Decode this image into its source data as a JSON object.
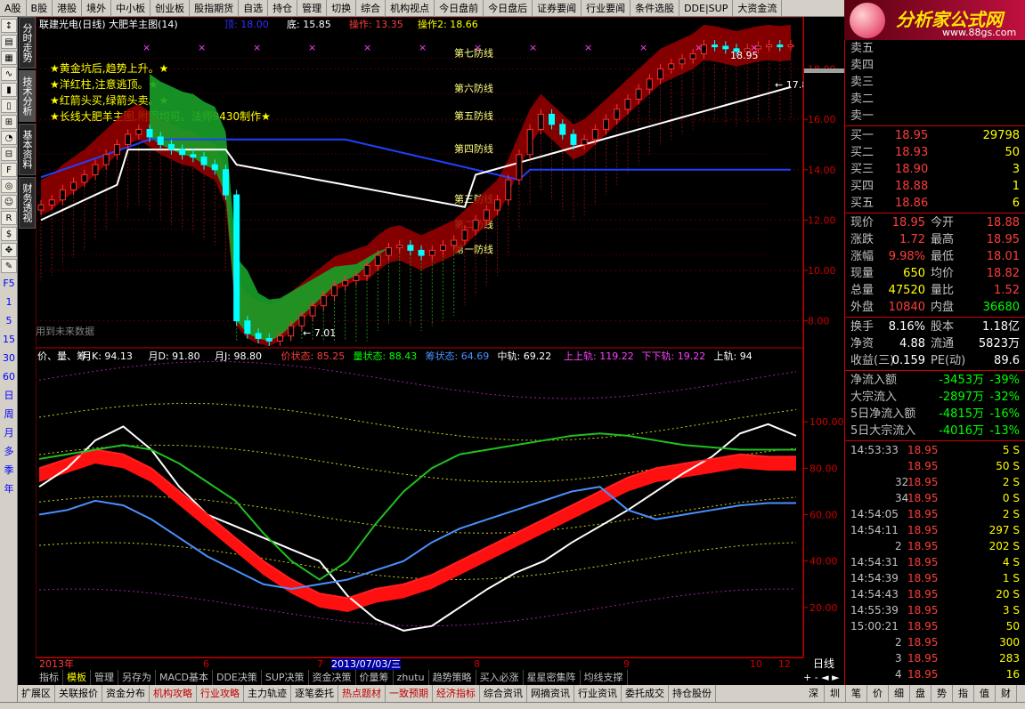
{
  "topnav": [
    "A股",
    "B股",
    "港股",
    "境外",
    "中小板",
    "创业板",
    "股指期货",
    "自选",
    "持仓",
    "管理",
    "切换",
    "综合",
    "机构视点",
    "今日盘前",
    "今日盘后",
    "证券要闻",
    "行业要闻",
    "条件选股",
    "DDE|SUP",
    "大资金流"
  ],
  "logo": {
    "title": "分析家公式网",
    "url": "www.88gs.com"
  },
  "sidetabs": [
    "分时走势",
    "技术分析",
    "基本资料",
    "财务透视"
  ],
  "leftbar_icons": [
    "arrow-icon",
    "chart-icon",
    "grid-icon",
    "line-icon",
    "bar-icon",
    "candle-icon",
    "fund-icon",
    "pie-icon",
    "grid2-icon",
    "fiz-icon",
    "circle-icon",
    "people-icon",
    "rsi-icon",
    "dollar-icon",
    "move-icon",
    "pen-icon"
  ],
  "leftbar_nums": [
    "F5",
    "1",
    "5",
    "15",
    "30",
    "60",
    "日",
    "周",
    "月",
    "多",
    "季",
    "年"
  ],
  "chart": {
    "header": {
      "name": "联建光电(日线) 大肥羊主图(14)",
      "items": [
        {
          "label": "顶: 18.00",
          "color": "#3030ff"
        },
        {
          "label": "底: 15.85",
          "color": "#ffffff"
        },
        {
          "label": "操作: 13.35",
          "color": "#ff3c3c"
        },
        {
          "label": "操作2: 18.66",
          "color": "#ffff00"
        }
      ]
    },
    "notes": [
      "★黄金坑后,趋势上升。★",
      "★洋红柱,注意逃顶。★",
      "★红箭头买,绿箭头卖。★",
      "★长线大肥羊主图,附图均可。法师9430制作★"
    ],
    "defense_lines": [
      "第七防线",
      "第六防线",
      "第五防线",
      "第四防线",
      "第三防线",
      "第二防线",
      "第一防线"
    ],
    "annotations": {
      "low": "7.01",
      "high": "18.95",
      "mark": "17.80",
      "future": "用到未来数据"
    },
    "sub_header": {
      "name": "价、量、筹",
      "items": [
        {
          "label": "月K: 94.13",
          "color": "#ffffff"
        },
        {
          "label": "月D: 91.80",
          "color": "#ffffff"
        },
        {
          "label": "月J: 98.80",
          "color": "#ffffff"
        },
        {
          "label": "价状态: 85.25",
          "color": "#ff3c3c"
        },
        {
          "label": "量状态: 88.43",
          "color": "#00ff00"
        },
        {
          "label": "筹状态: 64.69",
          "color": "#4a90ff"
        },
        {
          "label": "中轨: 69.22",
          "color": "#ffffff"
        },
        {
          "label": "上上轨: 119.22",
          "color": "#ff40ff"
        },
        {
          "label": "下下轨: 19.22",
          "color": "#ff40ff"
        },
        {
          "label": "上轨: 94",
          "color": "#ffffff"
        }
      ]
    },
    "dates": {
      "year": "2013年",
      "m6": "6",
      "m7": "7",
      "cursor": "2013/07/03/三",
      "m8": "8",
      "m9": "9",
      "m10": "10",
      "m12": "12"
    },
    "period": "日线"
  },
  "chart_data": [
    {
      "type": "line",
      "title": "联建光电(日线) 大肥羊主图(14)",
      "ylim": [
        7,
        19.5
      ],
      "yticks": [
        8,
        10,
        12,
        14,
        16,
        18
      ],
      "x": [
        1,
        2,
        3,
        4,
        5,
        6,
        7,
        8,
        9,
        10,
        11,
        12,
        13,
        14,
        15,
        16,
        17,
        18,
        19,
        20,
        21,
        22,
        23,
        24,
        25,
        26,
        27,
        28,
        29,
        30,
        31,
        32,
        33,
        34,
        35,
        36,
        37,
        38,
        39,
        40,
        41,
        42,
        43,
        44,
        45,
        46,
        47,
        48,
        49,
        50,
        51,
        52,
        53,
        54,
        55,
        56,
        57,
        58,
        59,
        60,
        61,
        62,
        63,
        64,
        65,
        66,
        67,
        68,
        69,
        70
      ],
      "close": [
        12.6,
        12.8,
        13.2,
        13.5,
        13.8,
        14.2,
        14.6,
        15.0,
        15.4,
        15.6,
        15.3,
        15.0,
        14.8,
        14.6,
        14.5,
        14.2,
        14.0,
        13.0,
        8.0,
        7.5,
        7.3,
        7.2,
        7.4,
        7.8,
        8.2,
        8.6,
        9.0,
        9.4,
        9.6,
        9.8,
        10.2,
        10.6,
        10.9,
        11.0,
        10.8,
        10.6,
        10.8,
        11.0,
        11.2,
        11.6,
        12.0,
        12.4,
        12.8,
        13.6,
        14.6,
        15.6,
        16.2,
        15.8,
        15.4,
        15.0,
        15.2,
        15.6,
        16.0,
        16.4,
        16.8,
        17.2,
        17.6,
        18.0,
        18.2,
        18.4,
        18.6,
        18.95,
        18.9,
        18.8,
        18.7,
        18.8,
        18.9,
        18.95,
        18.9,
        18.95
      ]
    },
    {
      "type": "line",
      "title": "价、量、筹",
      "ylim": [
        0,
        125
      ],
      "yticks": [
        20,
        40,
        60,
        80,
        100
      ],
      "series": [
        {
          "name": "月K",
          "values": [
            72,
            80,
            92,
            98,
            88,
            72,
            60,
            55,
            50,
            45,
            40,
            25,
            15,
            10,
            12,
            20,
            28,
            35,
            40,
            48,
            55,
            62,
            70,
            78,
            85,
            95,
            99,
            94
          ]
        },
        {
          "name": "价状态",
          "values": [
            80,
            84,
            88,
            86,
            80,
            70,
            60,
            50,
            40,
            32,
            26,
            24,
            28,
            30,
            34,
            40,
            46,
            52,
            58,
            64,
            70,
            76,
            80,
            82,
            84,
            86,
            85,
            85
          ]
        },
        {
          "name": "量状态",
          "values": [
            84,
            86,
            88,
            90,
            88,
            82,
            74,
            66,
            52,
            40,
            32,
            40,
            56,
            70,
            80,
            86,
            88,
            90,
            92,
            94,
            95,
            94,
            92,
            90,
            89,
            88,
            88,
            88
          ]
        },
        {
          "name": "筹状态",
          "values": [
            60,
            62,
            66,
            64,
            58,
            50,
            42,
            36,
            30,
            28,
            30,
            32,
            36,
            40,
            48,
            54,
            58,
            62,
            66,
            70,
            72,
            62,
            58,
            60,
            62,
            64,
            65,
            65
          ]
        }
      ]
    }
  ],
  "quote": {
    "sell": [
      {
        "label": "卖五"
      },
      {
        "label": "卖四"
      },
      {
        "label": "卖三"
      },
      {
        "label": "卖二"
      },
      {
        "label": "卖一"
      }
    ],
    "buy": [
      {
        "label": "买一",
        "price": "18.95",
        "vol": "29798"
      },
      {
        "label": "买二",
        "price": "18.93",
        "vol": "50"
      },
      {
        "label": "买三",
        "price": "18.90",
        "vol": "3"
      },
      {
        "label": "买四",
        "price": "18.88",
        "vol": "1"
      },
      {
        "label": "买五",
        "price": "18.86",
        "vol": "6"
      }
    ],
    "stats": [
      {
        "a": "现价",
        "b": "18.95",
        "bc": "red",
        "c": "今开",
        "d": "18.88",
        "dc": "red"
      },
      {
        "a": "涨跌",
        "b": "1.72",
        "bc": "red",
        "c": "最高",
        "d": "18.95",
        "dc": "red"
      },
      {
        "a": "涨幅",
        "b": "9.98%",
        "bc": "red",
        "c": "最低",
        "d": "18.01",
        "dc": "red"
      },
      {
        "a": "现量",
        "b": "650",
        "bc": "yellow",
        "c": "均价",
        "d": "18.82",
        "dc": "red"
      },
      {
        "a": "总量",
        "b": "47520",
        "bc": "yellow",
        "c": "量比",
        "d": "1.52",
        "dc": "red"
      },
      {
        "a": "外盘",
        "b": "10840",
        "bc": "red",
        "c": "内盘",
        "d": "36680",
        "dc": "green"
      }
    ],
    "stats2": [
      {
        "a": "换手",
        "b": "8.16%",
        "bc": "white",
        "c": "股本",
        "d": "1.18亿",
        "dc": "white"
      },
      {
        "a": "净资",
        "b": "4.88",
        "bc": "white",
        "c": "流通",
        "d": "5823万",
        "dc": "white"
      },
      {
        "a": "收益(三)",
        "b": "0.159",
        "bc": "white",
        "c": "PE(动)",
        "d": "89.6",
        "dc": "white"
      }
    ],
    "flows": [
      {
        "a": "净流入额",
        "b": "-3453万",
        "c": "-39%"
      },
      {
        "a": "大宗流入",
        "b": "-2897万",
        "c": "-32%"
      },
      {
        "a": "5日净流入额",
        "b": "-4815万",
        "c": "-16%"
      },
      {
        "a": "5日大宗流入",
        "b": "-4016万",
        "c": "-13%"
      }
    ],
    "ticks": [
      {
        "t": "14:53:33",
        "p": "18.95",
        "v": "5",
        "s": "S"
      },
      {
        "t": "",
        "p": "18.95",
        "v": "50",
        "s": "S"
      },
      {
        "t": "32",
        "p": "18.95",
        "v": "2",
        "s": "S"
      },
      {
        "t": "34",
        "p": "18.95",
        "v": "0",
        "s": "S"
      },
      {
        "t": "14:54:05",
        "p": "18.95",
        "v": "2",
        "s": "S"
      },
      {
        "t": "14:54:11",
        "p": "18.95",
        "v": "297",
        "s": "S"
      },
      {
        "t": "2",
        "p": "18.95",
        "v": "202",
        "s": "S"
      },
      {
        "t": "14:54:31",
        "p": "18.95",
        "v": "4",
        "s": "S"
      },
      {
        "t": "14:54:39",
        "p": "18.95",
        "v": "1",
        "s": "S"
      },
      {
        "t": "14:54:43",
        "p": "18.95",
        "v": "20",
        "s": "S"
      },
      {
        "t": "14:55:39",
        "p": "18.95",
        "v": "3",
        "s": "S"
      },
      {
        "t": "15:00:21",
        "p": "18.95",
        "v": "50",
        "s": ""
      },
      {
        "t": "2",
        "p": "18.95",
        "v": "300",
        "s": ""
      },
      {
        "t": "3",
        "p": "18.95",
        "v": "283",
        "s": ""
      },
      {
        "t": "4",
        "p": "18.95",
        "v": "16",
        "s": ""
      }
    ]
  },
  "bottomtabs": [
    "指标",
    "模板",
    "管理",
    "另存为",
    "MACD基本",
    "DDE决策",
    "SUP决策",
    "资金决策",
    "价量筹",
    "zhutu",
    "趋势策略",
    "买入必涨",
    "星星密集阵",
    "均线支撑"
  ],
  "bottomnav": [
    "扩展区",
    "关联报价",
    "资金分布",
    "机构攻略",
    "行业攻略",
    "主力轨迹",
    "逐笔委托",
    "热点题材",
    "一致预期",
    "经济指标",
    "综合资讯",
    "网摘资讯",
    "行业资讯",
    "委托成交",
    "持仓股份"
  ],
  "rbottom": [
    "深",
    "圳",
    "笔",
    "价",
    "细",
    "盘",
    "势",
    "指",
    "值",
    "财"
  ],
  "colors": {
    "red": "#ff3c3c",
    "green": "#00ff00",
    "blue": "#3030ff",
    "bg": "#000000",
    "grid": "#c00000"
  }
}
